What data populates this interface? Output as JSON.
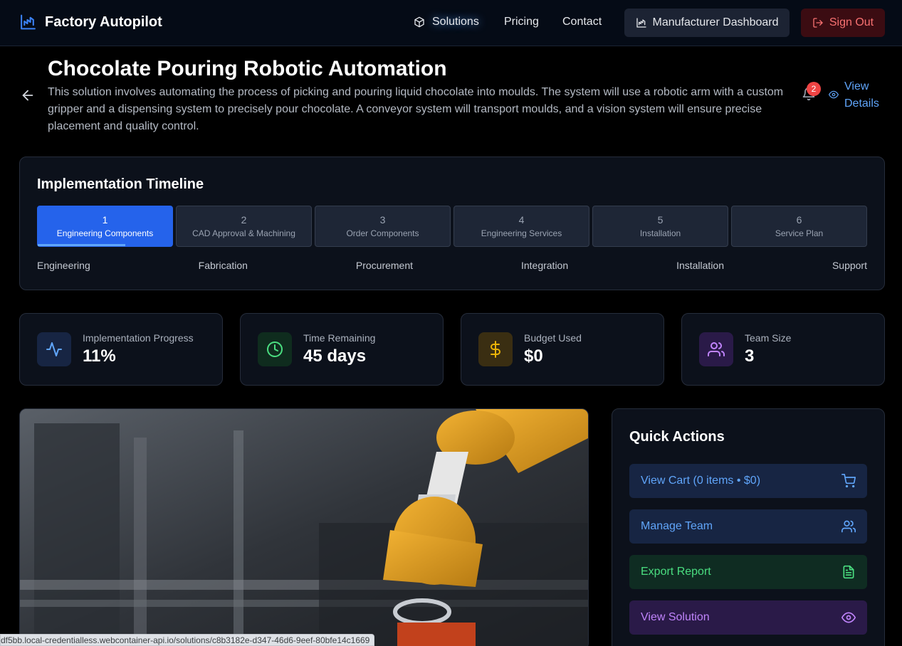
{
  "nav": {
    "brand": "Factory Autopilot",
    "links": {
      "solutions": "Solutions",
      "pricing": "Pricing",
      "contact": "Contact"
    },
    "dashboard_label": "Manufacturer Dashboard",
    "signout_label": "Sign Out"
  },
  "header": {
    "title": "Chocolate Pouring Robotic Automation",
    "description": "This solution involves automating the process of picking and pouring liquid chocolate into moulds. The system will use a robotic arm with a custom gripper and a dispensing system to precisely pour chocolate. A conveyor system will transport moulds, and a vision system will ensure precise placement and quality control.",
    "notification_count": "2",
    "view_details_label": "View Details"
  },
  "timeline": {
    "title": "Implementation Timeline",
    "active_step_progress": 0.65,
    "steps": [
      {
        "num": "1",
        "label": "Engineering Components"
      },
      {
        "num": "2",
        "label": "CAD Approval & Machining"
      },
      {
        "num": "3",
        "label": "Order Components"
      },
      {
        "num": "4",
        "label": "Engineering Services"
      },
      {
        "num": "5",
        "label": "Installation"
      },
      {
        "num": "6",
        "label": "Service Plan"
      }
    ],
    "phases": [
      "Engineering",
      "Fabrication",
      "Procurement",
      "Integration",
      "Installation",
      "Support"
    ]
  },
  "stats": {
    "progress": {
      "label": "Implementation Progress",
      "value": "11%"
    },
    "time": {
      "label": "Time Remaining",
      "value": "45 days"
    },
    "budget": {
      "label": "Budget Used",
      "value": "$0"
    },
    "team": {
      "label": "Team Size",
      "value": "3"
    }
  },
  "quick_actions": {
    "title": "Quick Actions",
    "cart": "View Cart (0 items • $0)",
    "team": "Manage Team",
    "export": "Export Report",
    "solution": "View Solution"
  },
  "status_bar_url": "df5bb.local-credentialless.webcontainer-api.io/solutions/c8b3182e-d347-46d6-9eef-80bfe14c1669",
  "colors": {
    "accent_blue": "#2563eb",
    "danger": "#ef4444",
    "success": "#4ade80",
    "budget": "#eab308",
    "purple": "#c084fc"
  }
}
